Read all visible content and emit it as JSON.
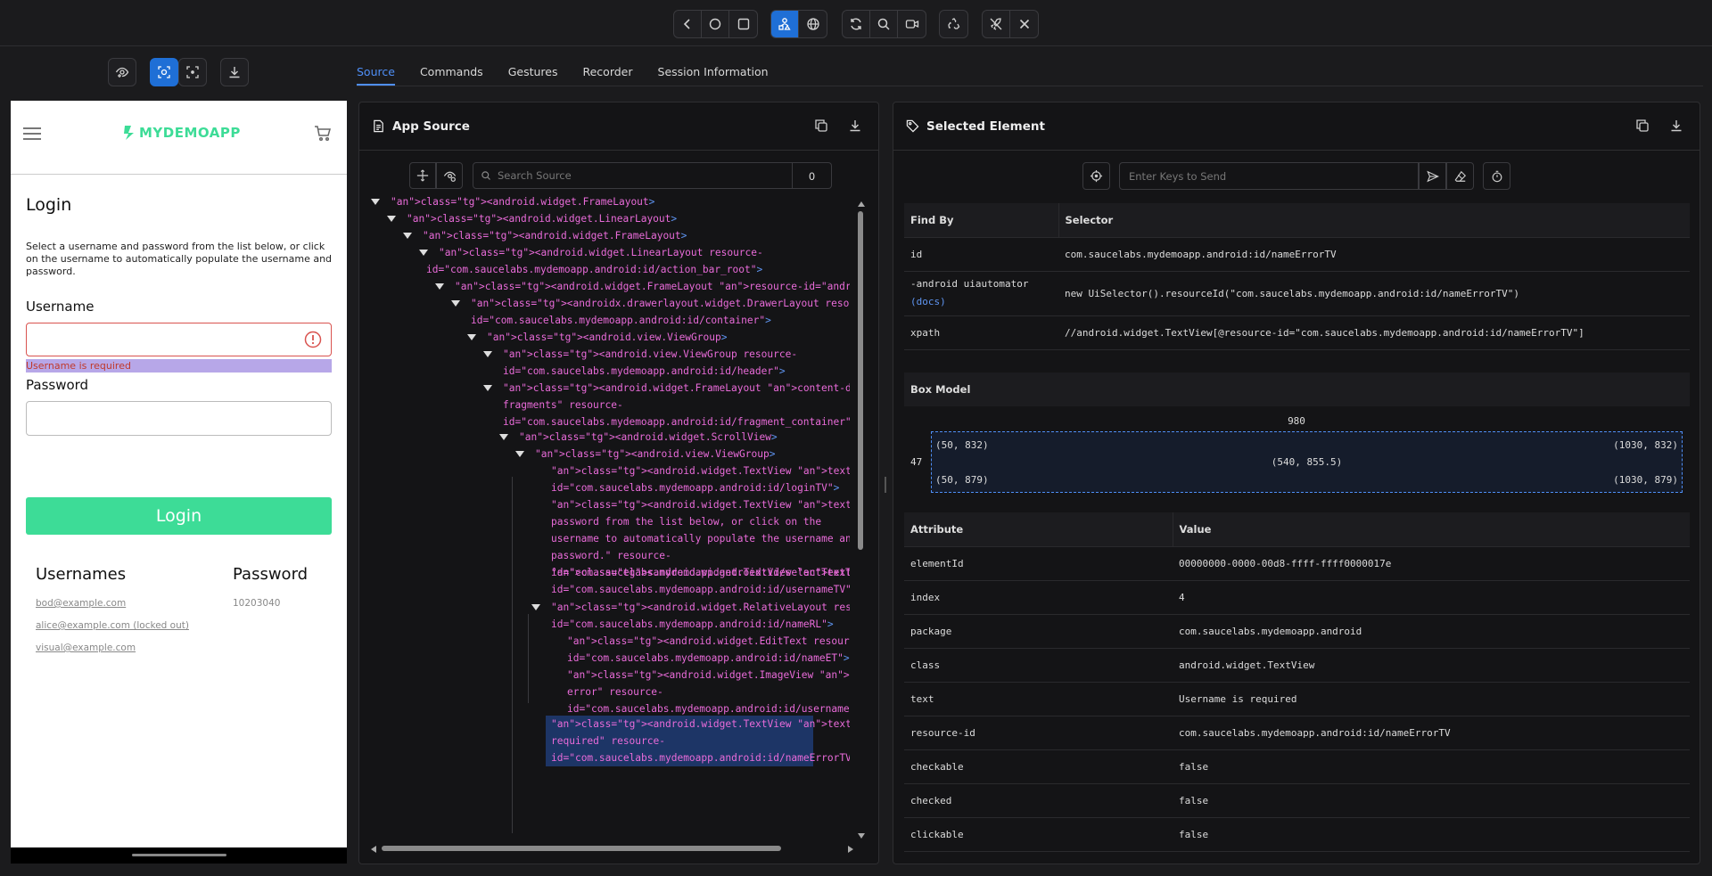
{
  "toolbar": {
    "groups": [
      [
        "chevron-left-icon",
        "circle-home-icon",
        "square-overview-icon"
      ],
      [
        "select-element-icon",
        "globe-icon"
      ],
      [
        "refresh-icon",
        "search-icon",
        "record-icon"
      ],
      [
        "recycle-icon"
      ],
      [
        "rocket-off-icon",
        "close-icon"
      ]
    ]
  },
  "screenshot_tools": [
    "eye-plus-icon",
    "select-icon",
    "crop-icon",
    "download-icon"
  ],
  "tabs": [
    "Source",
    "Commands",
    "Gestures",
    "Recorder",
    "Session Information"
  ],
  "app": {
    "logo": "MYDEMOAPP",
    "title": "Login",
    "intro": "Select a username and password from the list below, or click on the username to automatically populate the username and password.",
    "username_label": "Username",
    "username_error": "Username is required",
    "password_label": "Password",
    "login_button": "Login",
    "usernames_heading": "Usernames",
    "password_heading": "Password",
    "users": [
      "bod@example.com",
      "alice@example.com (locked out)",
      "visual@example.com"
    ],
    "password_value": "10203040"
  },
  "source": {
    "title": "App Source",
    "search_placeholder": "Search Source",
    "search_count": "0"
  },
  "selected": {
    "title": "Selected Element",
    "keys_placeholder": "Enter Keys to Send",
    "find_headers": [
      "Find By",
      "Selector"
    ],
    "find_rows": [
      [
        "id",
        "com.saucelabs.mydemoapp.android:id/nameErrorTV"
      ],
      [
        "-android uiautomator",
        "new UiSelector().resourceId(\"com.saucelabs.mydemoapp.android:id/nameErrorTV\")"
      ],
      [
        "xpath",
        "//android.widget.TextView[@resource-id=\"com.saucelabs.mydemoapp.android:id/nameErrorTV\"]"
      ]
    ],
    "docs_link": "(docs)",
    "box_title": "Box Model",
    "box_width": "980",
    "box_height": "47",
    "box_tl": "(50, 832)",
    "box_tr": "(1030, 832)",
    "box_center": "(540, 855.5)",
    "box_bl": "(50, 879)",
    "box_br": "(1030, 879)",
    "attr_headers": [
      "Attribute",
      "Value"
    ],
    "attrs": [
      [
        "elementId",
        "00000000-0000-00d8-ffff-ffff0000017e"
      ],
      [
        "index",
        "4"
      ],
      [
        "package",
        "com.saucelabs.mydemoapp.android"
      ],
      [
        "class",
        "android.widget.TextView"
      ],
      [
        "text",
        "Username is required"
      ],
      [
        "resource-id",
        "com.saucelabs.mydemoapp.android:id/nameErrorTV"
      ],
      [
        "checkable",
        "false"
      ],
      [
        "checked",
        "false"
      ],
      [
        "clickable",
        "false"
      ]
    ]
  },
  "tree": [
    {
      "l": "<android.widget.FrameLayout>"
    },
    {
      "l": "<android.widget.LinearLayout>"
    },
    {
      "l": "<android.widget.FrameLayout>"
    },
    {
      "l": "<android.widget.LinearLayout resource-",
      "c": "id=\"com.saucelabs.mydemoapp.android:id/action_bar_root\">"
    },
    {
      "l": "<android.widget.FrameLayout resource-id=\"android:id/content\">"
    },
    {
      "l": "<androidx.drawerlayout.widget.DrawerLayout resource-",
      "c": "id=\"com.saucelabs.mydemoapp.android:id/container\">"
    },
    {
      "l": "<android.view.ViewGroup>"
    },
    {
      "l": "<android.view.ViewGroup resource-",
      "c": "id=\"com.saucelabs.mydemoapp.android:id/header\">"
    },
    {
      "l": "<android.widget.FrameLayout content-desc=\"Container for",
      "c": "fragments\" resource-",
      "d": "id=\"com.saucelabs.mydemoapp.android:id/fragment_container\">"
    },
    {
      "l": "<android.widget.ScrollView>"
    },
    {
      "l": "<android.view.ViewGroup>"
    },
    {
      "l": "<android.widget.TextView text=\"Login\" resource-",
      "c": "id=\"com.saucelabs.mydemoapp.android:id/loginTV\">"
    },
    {
      "l": "<android.widget.TextView text=\"Select a username and",
      "c": "password from the list below, or click on the",
      "d": "username to automatically populate the username and",
      "e": "password.\" resource-",
      "f": "id=\"com.saucelabs.mydemoapp.android:id/selectTextTV\">"
    },
    {
      "l": "<android.widget.TextView text=\"Username\" resource-",
      "c": "id=\"com.saucelabs.mydemoapp.android:id/usernameTV\">"
    },
    {
      "l": "<android.widget.RelativeLayout resource-",
      "c": "id=\"com.saucelabs.mydemoapp.android:id/nameRL\">"
    },
    {
      "l": "<android.widget.EditText resource-",
      "c": "id=\"com.saucelabs.mydemoapp.android:id/nameET\">"
    },
    {
      "l": "<android.widget.ImageView content-desc=\"Indicates",
      "c": "error\" resource-",
      "d": "id=\"com.saucelabs.mydemoapp.android:id/usernameErrorIV\">"
    },
    {
      "l": "<android.widget.TextView text=\"Username is",
      "c": "required\" resource-",
      "d": "id=\"com.saucelabs.mydemoapp.android:id/nameErrorTV\">"
    }
  ]
}
